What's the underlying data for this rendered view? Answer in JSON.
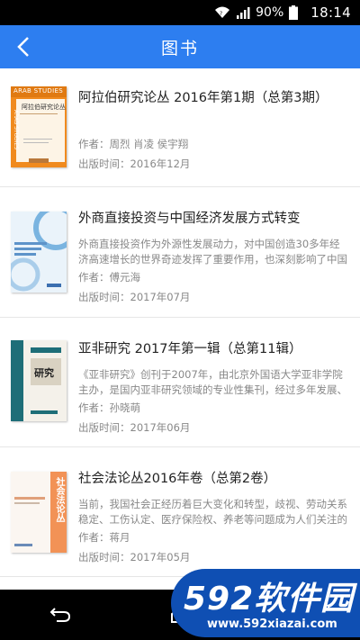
{
  "status_bar": {
    "battery": "90%",
    "time": "18:14"
  },
  "header": {
    "title": "图书"
  },
  "books": [
    {
      "title": "阿拉伯研究论丛 2016年第1期（总第3期）",
      "description": "",
      "author": "作者：周烈 肖凌 侯宇翔",
      "publish_time": "出版时间：2016年12月",
      "cover_top_text": "ARAB STUDIES",
      "cover_title": "阿拉伯研究论丛",
      "cover_side_text": "ARAB STUDIES",
      "cover_color": "#f08a1e"
    },
    {
      "title": "外商直接投资与中国经济发展方式转变",
      "description": "外商直接投资作为外源性发展动力，对中国创造30多年经济高速增长的世界奇迹发挥了重要作用，也深刻影响了中国",
      "author": "作者：傅元海",
      "publish_time": "出版时间：2017年07月",
      "cover_title": "外商直接投资与中国经济发展方式转变",
      "cover_color": "#6fa8d6"
    },
    {
      "title": "亚非研究 2017年第一辑（总第11辑）",
      "description": "《亚非研究》创刊于2007年，由北京外国语大学亚非学院主办，是国内亚非研究领域的专业性集刊，经过多年发展、积",
      "author": "作者：孙晓萌",
      "publish_time": "出版时间：2017年06月",
      "cover_title": "亚非研究",
      "cover_color": "#1e6e78"
    },
    {
      "title": "社会法论丛2016年卷（总第2卷）",
      "description": "当前，我国社会正经历着巨大变化和转型，歧视、劳动关系稳定、工伤认定、医疗保险权、养老等问题成为人们关注的",
      "author": "作者：蒋月",
      "publish_time": "出版时间：2017年05月",
      "cover_title": "社会法论丛",
      "cover_color": "#f29256"
    }
  ],
  "watermark": {
    "big": "592软件园",
    "url": "www.592xiazai.com"
  }
}
